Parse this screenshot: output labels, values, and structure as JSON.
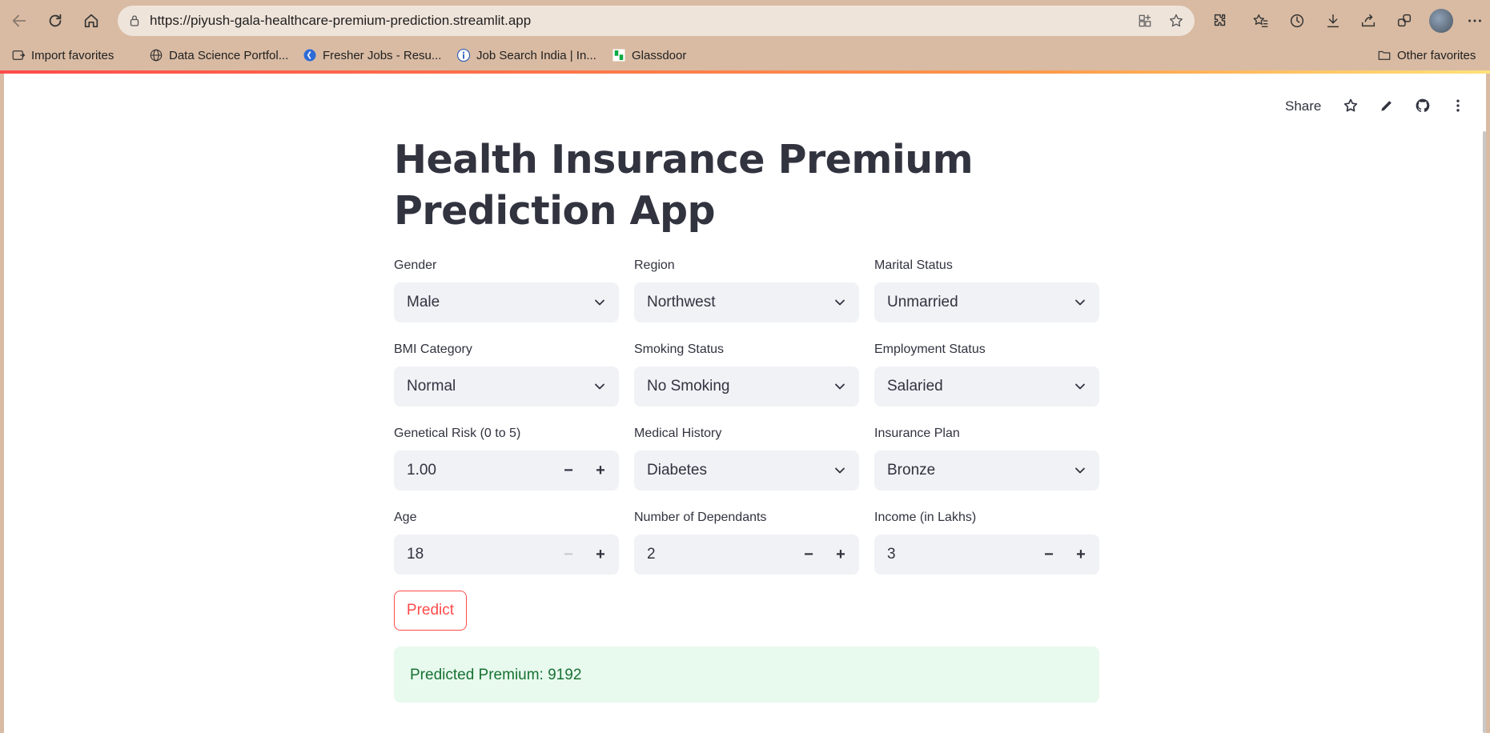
{
  "browser": {
    "url": "https://piyush-gala-healthcare-premium-prediction.streamlit.app",
    "bookmarks": [
      {
        "label": "Import favorites",
        "icon": "import-icon"
      },
      {
        "label": "Data Science Portfol...",
        "icon": "globe-icon"
      },
      {
        "label": "Fresher Jobs - Resu...",
        "icon": "fresher-jobs-icon"
      },
      {
        "label": "Job Search India | In...",
        "icon": "info-icon"
      },
      {
        "label": "Glassdoor",
        "icon": "glassdoor-icon"
      }
    ],
    "other_favorites": "Other favorites"
  },
  "header": {
    "share_label": "Share"
  },
  "main": {
    "title": "Health Insurance Premium Prediction App",
    "fields": {
      "gender": {
        "label": "Gender",
        "value": "Male"
      },
      "region": {
        "label": "Region",
        "value": "Northwest"
      },
      "marital_status": {
        "label": "Marital Status",
        "value": "Unmarried"
      },
      "bmi_category": {
        "label": "BMI Category",
        "value": "Normal"
      },
      "smoking_status": {
        "label": "Smoking Status",
        "value": "No Smoking"
      },
      "employment_status": {
        "label": "Employment Status",
        "value": "Salaried"
      },
      "genetical_risk": {
        "label": "Genetical Risk (0 to 5)",
        "value": "1.00"
      },
      "medical_history": {
        "label": "Medical History",
        "value": "Diabetes"
      },
      "insurance_plan": {
        "label": "Insurance Plan",
        "value": "Bronze"
      },
      "age": {
        "label": "Age",
        "value": "18"
      },
      "dependants": {
        "label": "Number of Dependants",
        "value": "2"
      },
      "income": {
        "label": "Income (in Lakhs)",
        "value": "3"
      }
    },
    "predict_label": "Predict",
    "result_text": "Predicted Premium: 9192"
  },
  "colors": {
    "accent": "#ff4b4b",
    "success_bg": "#e8f9ee",
    "success_text": "#177233",
    "input_bg": "#f0f2f6",
    "chrome_bg": "#d9bba3"
  }
}
